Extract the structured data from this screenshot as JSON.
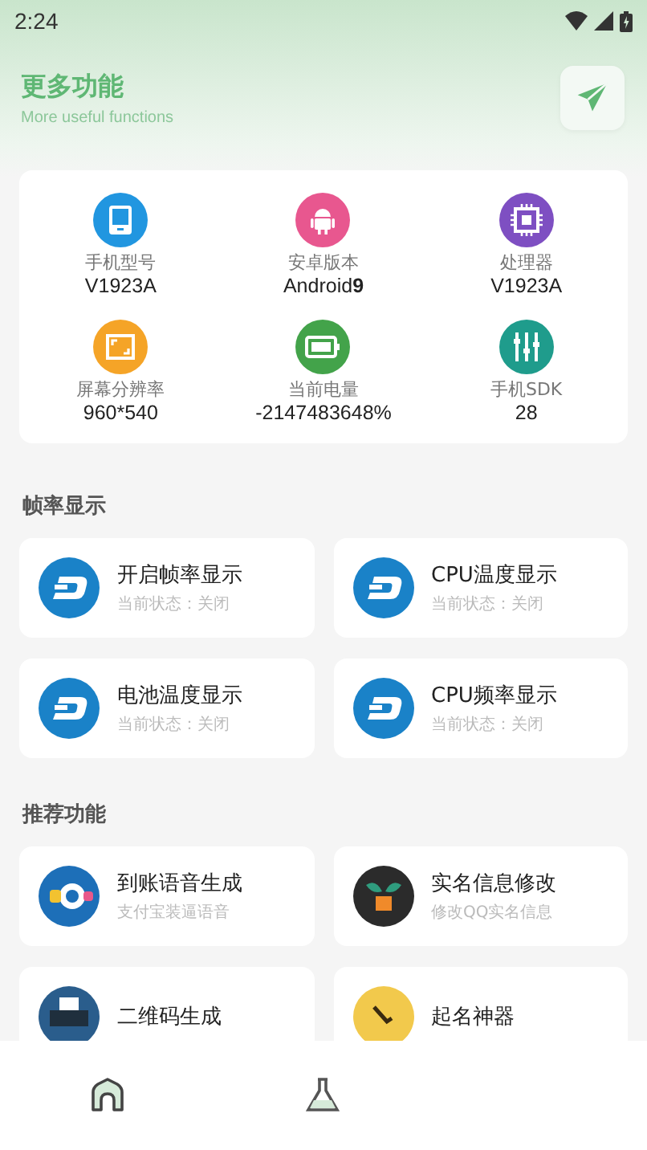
{
  "status_bar": {
    "time": "2:24"
  },
  "header": {
    "title": "更多功能",
    "subtitle": "More useful functions"
  },
  "device_info": [
    {
      "label": "手机型号",
      "value": "V1923A",
      "color": "#2196e0"
    },
    {
      "label": "安卓版本",
      "value": "Android**9**",
      "color": "#e8578f"
    },
    {
      "label": "处理器",
      "value": "V1923A",
      "color": "#7e4fc2"
    },
    {
      "label": "屏幕分辨率",
      "value": "960*540",
      "color": "#f5a427"
    },
    {
      "label": "当前电量",
      "value": "-2147483648%",
      "color": "#43a34a"
    },
    {
      "label": "手机SDK",
      "value": "28",
      "color": "#1f9c8c"
    }
  ],
  "sections": [
    {
      "title": "帧率显示",
      "items": [
        {
          "title": "开启帧率显示",
          "subtitle": "当前状态：关闭"
        },
        {
          "title": "CPU温度显示",
          "subtitle": "当前状态：关闭"
        },
        {
          "title": "电池温度显示",
          "subtitle": "当前状态：关闭"
        },
        {
          "title": "CPU频率显示",
          "subtitle": "当前状态：关闭"
        }
      ]
    },
    {
      "title": "推荐功能",
      "items": [
        {
          "title": "到账语音生成",
          "subtitle": "支付宝装逼语音"
        },
        {
          "title": "实名信息修改",
          "subtitle": "修改QQ实名信息"
        },
        {
          "title": "二维码生成"
        },
        {
          "title": "起名神器"
        }
      ]
    }
  ],
  "bottom_nav": [
    {
      "selected": true
    },
    {
      "selected": false
    }
  ]
}
